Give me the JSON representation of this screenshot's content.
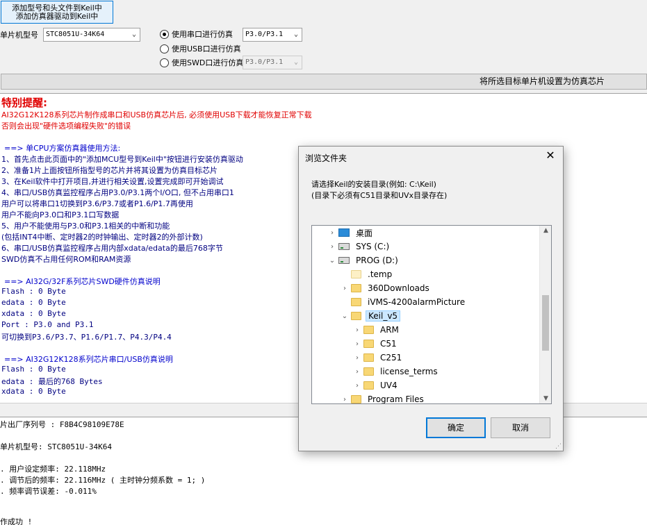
{
  "toolbar": {
    "add_button_line1": "添加型号和头文件到Keil中",
    "add_button_line2": "添加仿真器驱动到Keil中"
  },
  "mcu": {
    "label": "单片机型号",
    "value": "STC8051U-34K64"
  },
  "sim_options": [
    {
      "label": "使用串口进行仿真",
      "selected": true,
      "port": "P3.0/P3.1",
      "enabled": true
    },
    {
      "label": "使用USB口进行仿真",
      "selected": false
    },
    {
      "label": "使用SWD口进行仿真",
      "selected": false,
      "port": "P3.0/P3.1",
      "enabled": false
    }
  ],
  "set_target_button": "将所选目标单片机设置为仿真芯片",
  "info": {
    "title": "特别提醒:",
    "warn1": "AI32G12K128系列芯片制作成串口和USB仿真芯片后, 必须使用USB下载才能恢复正常下载",
    "warn2": "否则会出现\"硬件选项编程失败\"的错误",
    "section1": "==> 单CPU方案仿真器使用方法:",
    "steps": [
      "1、首先点击此页面中的\"添加MCU型号到Keil中\"按钮进行安装仿真驱动",
      "2、准备1片上面按钮所指型号的芯片并将其设置为仿真目标芯片",
      "3、在Keil软件中打开项目,并进行相关设置,设置完成即可开始调试",
      "4、串口/USB仿真监控程序占用P3.0/P3.1两个I/O口, 但不占用串口1",
      "    用户可以将串口1切换到P3.6/P3.7或者P1.6/P1.7再使用",
      "    用户不能向P3.0口和P3.1口写数据",
      "5、用户不能使用与P3.0和P3.1相关的中断和功能",
      "  (包括INT4中断、定时器2的时钟输出、定时器2的外部计数)",
      "6、串口/USB仿真监控程序占用内部xdata/edata的最后768字节",
      "    SWD仿真不占用任何ROM和RAM资源"
    ],
    "section2": "==> AI32G/32F系列芯片SWD硬件仿真说明",
    "swd_lines": [
      "Flash : 0 Byte",
      "edata : 0 Byte",
      "xdata : 0 Byte",
      "Port  : P3.0 and P3.1",
      "        可切换到P3.6/P3.7、P1.6/P1.7、P4.3/P4.4"
    ],
    "section3": "==> AI32G12K128系列芯片串口/USB仿真说明",
    "usb_lines": [
      "Flash : 0 Byte",
      "edata : 最后的768 Bytes",
      "xdata : 0 Byte"
    ]
  },
  "log": {
    "lines": [
      "片出厂序列号 : F8B4C98109E78E",
      "",
      "单片机型号: STC8051U-34K64",
      "",
      ". 用户设定频率: 22.118MHz",
      ". 调节后的频率: 22.116MHz ( 主时钟分频系数 = 1; )",
      ". 频率调节误差: -0.011%",
      "",
      "作成功 !"
    ]
  },
  "dialog": {
    "title": "浏览文件夹",
    "desc1": "请选择Keil的安装目录(例如: C:\\Keil)",
    "desc2": "(目录下必须有C51目录和UVx目录存在)",
    "tree": [
      {
        "label": "桌面",
        "level": 0,
        "twisty": "›",
        "icon": "desktop-icon"
      },
      {
        "label": "SYS (C:)",
        "level": 0,
        "twisty": "›",
        "icon": "drive-icon"
      },
      {
        "label": "PROG (D:)",
        "level": 0,
        "twisty": "⌄",
        "icon": "drive-icon"
      },
      {
        "label": ".temp",
        "level": 1,
        "twisty": "",
        "icon": "folder-icon"
      },
      {
        "label": "360Downloads",
        "level": 1,
        "twisty": "›",
        "icon": "folder-icon"
      },
      {
        "label": "iVMS-4200alarmPicture",
        "level": 1,
        "twisty": "",
        "icon": "folder-icon"
      },
      {
        "label": "Keil_v5",
        "level": 1,
        "twisty": "⌄",
        "icon": "folder-icon",
        "selected": true
      },
      {
        "label": "ARM",
        "level": 2,
        "twisty": "›",
        "icon": "folder-icon"
      },
      {
        "label": "C51",
        "level": 2,
        "twisty": "›",
        "icon": "folder-icon"
      },
      {
        "label": "C251",
        "level": 2,
        "twisty": "›",
        "icon": "folder-icon"
      },
      {
        "label": "license_terms",
        "level": 2,
        "twisty": "›",
        "icon": "folder-icon"
      },
      {
        "label": "UV4",
        "level": 2,
        "twisty": "›",
        "icon": "folder-icon"
      },
      {
        "label": "Program Files",
        "level": 1,
        "twisty": "›",
        "icon": "folder-icon"
      }
    ],
    "ok_label": "确定",
    "cancel_label": "取消"
  }
}
